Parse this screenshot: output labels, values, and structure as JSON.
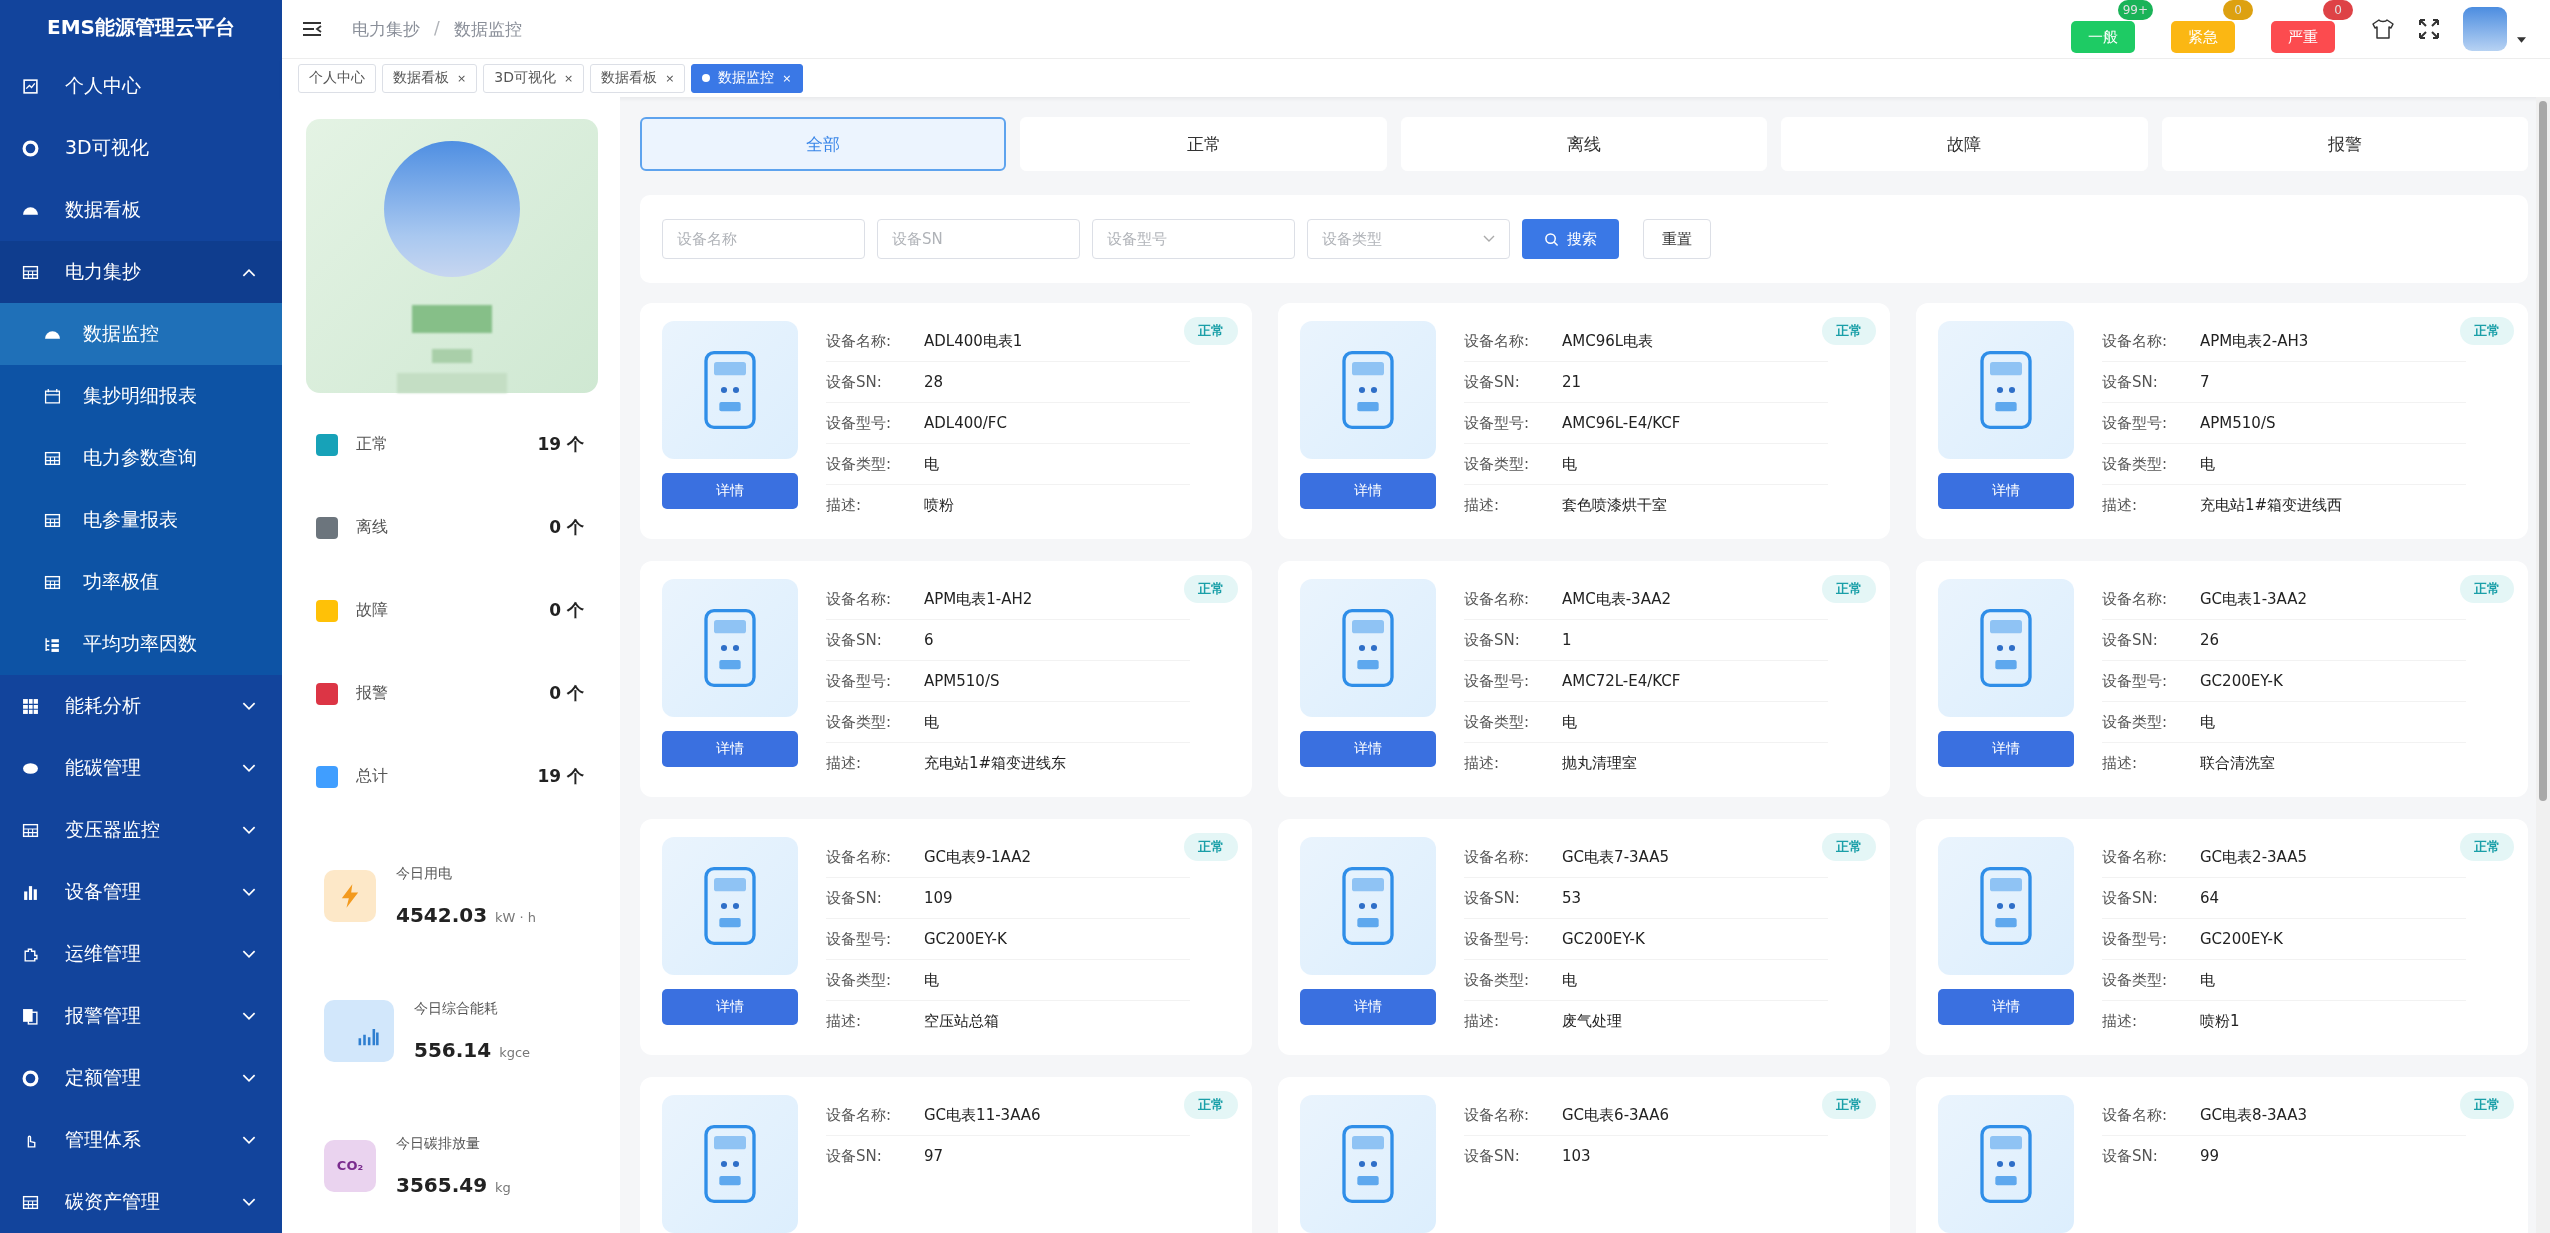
{
  "sidebar": {
    "title": "EMS能源管理云平台",
    "items": [
      {
        "label": "个人中心",
        "selected": false
      },
      {
        "label": "3D可视化",
        "selected": false
      },
      {
        "label": "数据看板",
        "selected": false
      },
      {
        "label": "电力集抄",
        "selected": false,
        "expanded": true,
        "children": [
          {
            "label": "数据监控",
            "selected": true
          },
          {
            "label": "集抄明细报表",
            "selected": false
          },
          {
            "label": "电力参数查询",
            "selected": false
          },
          {
            "label": "电参量报表",
            "selected": false
          },
          {
            "label": "功率极值",
            "selected": false
          },
          {
            "label": "平均功率因数",
            "selected": false
          }
        ]
      },
      {
        "label": "能耗分析",
        "selected": false,
        "expanded": false
      },
      {
        "label": "能碳管理",
        "selected": false,
        "expanded": false
      },
      {
        "label": "变压器监控",
        "selected": false,
        "expanded": false
      },
      {
        "label": "设备管理",
        "selected": false,
        "expanded": false
      },
      {
        "label": "运维管理",
        "selected": false,
        "expanded": false
      },
      {
        "label": "报警管理",
        "selected": false,
        "expanded": false
      },
      {
        "label": "定额管理",
        "selected": false,
        "expanded": false
      },
      {
        "label": "管理体系",
        "selected": false,
        "expanded": false
      },
      {
        "label": "碳资产管理",
        "selected": false,
        "expanded": false
      }
    ]
  },
  "header": {
    "breadcrumb": [
      "电力集抄",
      "数据监控"
    ],
    "separator": "/",
    "alerts": [
      {
        "label": "一般",
        "count": "99+",
        "color": "#1ecb64"
      },
      {
        "label": "紧急",
        "count": "0",
        "color": "#fbb713"
      },
      {
        "label": "严重",
        "count": "0",
        "color": "#fc4b4f"
      }
    ]
  },
  "tabs": [
    {
      "label": "个人中心",
      "selected": false
    },
    {
      "label": "数据看板",
      "close": "×",
      "selected": false
    },
    {
      "label": "3D可视化",
      "close": "×",
      "selected": false
    },
    {
      "label": "数据看板",
      "close": "×",
      "selected": false
    },
    {
      "label": "数据监控",
      "close": "×",
      "selected": true
    }
  ],
  "stats": [
    {
      "label": "正常",
      "value": "19 个",
      "color": "#17a2b8"
    },
    {
      "label": "离线",
      "value": "0 个",
      "color": "#6c757d"
    },
    {
      "label": "故障",
      "value": "0 个",
      "color": "#ffc107"
    },
    {
      "label": "报警",
      "value": "0 个",
      "color": "#dc3545"
    },
    {
      "label": "总计",
      "value": "19 个",
      "color": "#409eff"
    }
  ],
  "energy": [
    {
      "kind": "power",
      "label": "今日用电",
      "value": "4542.03",
      "unit": "kW · h"
    },
    {
      "kind": "energy",
      "label": "今日综合能耗",
      "value": "556.14",
      "unit": "kgce"
    },
    {
      "kind": "carbon",
      "label": "今日碳排放量",
      "value": "3565.49",
      "unit": "kg",
      "icon_text": "CO₂"
    }
  ],
  "status_tabs": [
    {
      "label": "全部",
      "selected": true
    },
    {
      "label": "正常",
      "selected": false
    },
    {
      "label": "离线",
      "selected": false
    },
    {
      "label": "故障",
      "selected": false
    },
    {
      "label": "报警",
      "selected": false
    }
  ],
  "filters": {
    "fields": [
      {
        "placeholder": "设备名称",
        "kind": "input"
      },
      {
        "placeholder": "设备SN",
        "kind": "input"
      },
      {
        "placeholder": "设备型号",
        "kind": "input"
      },
      {
        "placeholder": "设备类型",
        "kind": "select"
      }
    ],
    "search": "搜索",
    "reset": "重置"
  },
  "devices": [
    {
      "status": "正常",
      "kind": "normal",
      "button": "详情",
      "fields": [
        {
          "label": "设备名称:",
          "value": "ADL400电表1"
        },
        {
          "label": "设备SN:",
          "value": "28"
        },
        {
          "label": "设备型号:",
          "value": "ADL400/FC"
        },
        {
          "label": "设备类型:",
          "value": "电"
        },
        {
          "label": "描述:",
          "value": "喷粉"
        }
      ]
    },
    {
      "status": "正常",
      "kind": "normal",
      "button": "详情",
      "fields": [
        {
          "label": "设备名称:",
          "value": "AMC96L电表"
        },
        {
          "label": "设备SN:",
          "value": "21"
        },
        {
          "label": "设备型号:",
          "value": "AMC96L-E4/KCF"
        },
        {
          "label": "设备类型:",
          "value": "电"
        },
        {
          "label": "描述:",
          "value": "套色喷漆烘干室"
        }
      ]
    },
    {
      "status": "正常",
      "kind": "normal",
      "button": "详情",
      "fields": [
        {
          "label": "设备名称:",
          "value": "APM电表2-AH3"
        },
        {
          "label": "设备SN:",
          "value": "7"
        },
        {
          "label": "设备型号:",
          "value": "APM510/S"
        },
        {
          "label": "设备类型:",
          "value": "电"
        },
        {
          "label": "描述:",
          "value": "充电站1#箱变进线西"
        }
      ]
    },
    {
      "status": "正常",
      "kind": "normal",
      "button": "详情",
      "fields": [
        {
          "label": "设备名称:",
          "value": "APM电表1-AH2"
        },
        {
          "label": "设备SN:",
          "value": "6"
        },
        {
          "label": "设备型号:",
          "value": "APM510/S"
        },
        {
          "label": "设备类型:",
          "value": "电"
        },
        {
          "label": "描述:",
          "value": "充电站1#箱变进线东"
        }
      ]
    },
    {
      "status": "正常",
      "kind": "normal",
      "button": "详情",
      "fields": [
        {
          "label": "设备名称:",
          "value": "AMC电表-3AA2"
        },
        {
          "label": "设备SN:",
          "value": "1"
        },
        {
          "label": "设备型号:",
          "value": "AMC72L-E4/KCF"
        },
        {
          "label": "设备类型:",
          "value": "电"
        },
        {
          "label": "描述:",
          "value": "抛丸清理室"
        }
      ]
    },
    {
      "status": "正常",
      "kind": "normal",
      "button": "详情",
      "fields": [
        {
          "label": "设备名称:",
          "value": "GC电表1-3AA2"
        },
        {
          "label": "设备SN:",
          "value": "26"
        },
        {
          "label": "设备型号:",
          "value": "GC200EY-K"
        },
        {
          "label": "设备类型:",
          "value": "电"
        },
        {
          "label": "描述:",
          "value": "联合清洗室"
        }
      ]
    },
    {
      "status": "正常",
      "kind": "normal",
      "button": "详情",
      "fields": [
        {
          "label": "设备名称:",
          "value": "GC电表9-1AA2"
        },
        {
          "label": "设备SN:",
          "value": "109"
        },
        {
          "label": "设备型号:",
          "value": "GC200EY-K"
        },
        {
          "label": "设备类型:",
          "value": "电"
        },
        {
          "label": "描述:",
          "value": "空压站总箱"
        }
      ]
    },
    {
      "status": "正常",
      "kind": "normal",
      "button": "详情",
      "fields": [
        {
          "label": "设备名称:",
          "value": "GC电表7-3AA5"
        },
        {
          "label": "设备SN:",
          "value": "53"
        },
        {
          "label": "设备型号:",
          "value": "GC200EY-K"
        },
        {
          "label": "设备类型:",
          "value": "电"
        },
        {
          "label": "描述:",
          "value": "废气处理"
        }
      ]
    },
    {
      "status": "正常",
      "kind": "normal",
      "button": "详情",
      "fields": [
        {
          "label": "设备名称:",
          "value": "GC电表2-3AA5"
        },
        {
          "label": "设备SN:",
          "value": "64"
        },
        {
          "label": "设备型号:",
          "value": "GC200EY-K"
        },
        {
          "label": "设备类型:",
          "value": "电"
        },
        {
          "label": "描述:",
          "value": "喷粉1"
        }
      ]
    },
    {
      "status": "正常",
      "kind": "normal",
      "fields": [
        {
          "label": "设备名称:",
          "value": "GC电表11-3AA6"
        },
        {
          "label": "设备SN:",
          "value": "97"
        }
      ]
    },
    {
      "status": "正常",
      "kind": "normal",
      "fields": [
        {
          "label": "设备名称:",
          "value": "GC电表6-3AA6"
        },
        {
          "label": "设备SN:",
          "value": "103"
        }
      ]
    },
    {
      "status": "正常",
      "kind": "normal",
      "fields": [
        {
          "label": "设备名称:",
          "value": "GC电表8-3AA3"
        },
        {
          "label": "设备SN:",
          "value": "99"
        }
      ]
    }
  ]
}
